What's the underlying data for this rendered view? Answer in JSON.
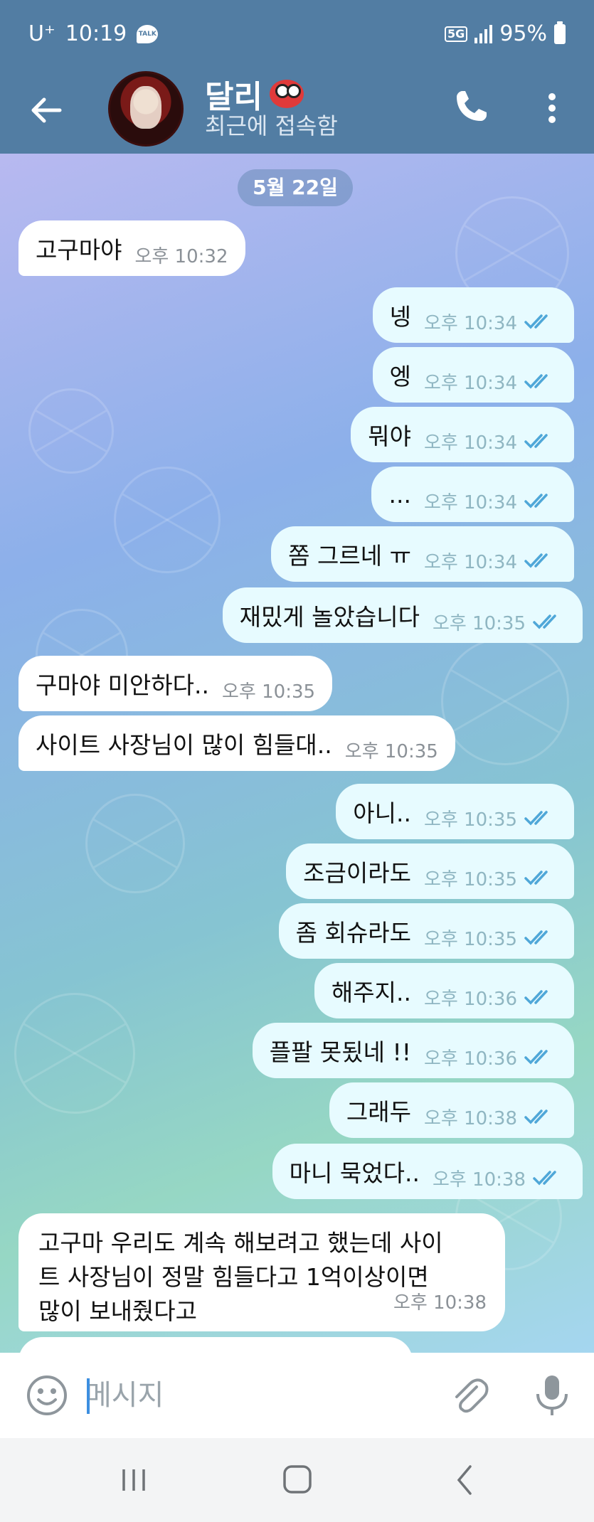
{
  "status_bar": {
    "carrier": "U⁺",
    "time": "10:19",
    "talk_badge": "TALK",
    "network": "5G",
    "battery": "95%"
  },
  "header": {
    "title": "달리",
    "subtitle": "최근에 접속함",
    "back_icon": "arrow-left-icon",
    "call_icon": "phone-icon",
    "menu_icon": "more-vertical-icon"
  },
  "chat": {
    "date_separator": "5월 22일",
    "messages": [
      {
        "dir": "in",
        "text": "고구마야",
        "time": "오후 10:32"
      },
      {
        "dir": "out",
        "text": "넹",
        "time": "오후 10:34"
      },
      {
        "dir": "out",
        "text": "엥",
        "time": "오후 10:34"
      },
      {
        "dir": "out",
        "text": "뭐야",
        "time": "오후 10:34"
      },
      {
        "dir": "out",
        "text": "...",
        "time": "오후 10:34"
      },
      {
        "dir": "out",
        "text": "쫌 그르네 ㅠ",
        "time": "오후 10:34"
      },
      {
        "dir": "out",
        "text": "재밌게 놀았습니다",
        "time": "오후 10:35"
      },
      {
        "dir": "in",
        "text": "구마야 미안하다..",
        "time": "오후 10:35"
      },
      {
        "dir": "in",
        "text": "사이트 사장님이 많이 힘들대..",
        "time": "오후 10:35"
      },
      {
        "dir": "out",
        "text": "아니..",
        "time": "오후 10:35"
      },
      {
        "dir": "out",
        "text": "조금이라도",
        "time": "오후 10:35"
      },
      {
        "dir": "out",
        "text": "좀 회슈라도",
        "time": "오후 10:35"
      },
      {
        "dir": "out",
        "text": "해주지..",
        "time": "오후 10:36"
      },
      {
        "dir": "out",
        "text": "플팔 못됬네 !!",
        "time": "오후 10:36"
      },
      {
        "dir": "out",
        "text": "그래두",
        "time": "오후 10:38"
      },
      {
        "dir": "out",
        "text": "마니 묵었다..",
        "time": "오후 10:38"
      },
      {
        "dir": "in",
        "text_lines": [
          "고구마 우리도 계속 해보려고 했는데 사이",
          "트 사장님이 정말 힘들다고 1억이상이면",
          "많이 보내줬다고"
        ],
        "time": "오후 10:38"
      }
    ]
  },
  "composer": {
    "placeholder": "메시지",
    "emoji_icon": "smile-icon",
    "attach_icon": "paperclip-icon",
    "mic_icon": "microphone-icon"
  },
  "system_nav": {
    "recents_icon": "recents-icon",
    "home_icon": "home-icon",
    "back_icon": "back-chevron-icon"
  },
  "colors": {
    "header_bg": "#527da3",
    "outgoing_bubble": "#e7fbff",
    "incoming_bubble": "#ffffff",
    "tick_color": "#4fa7d8"
  }
}
